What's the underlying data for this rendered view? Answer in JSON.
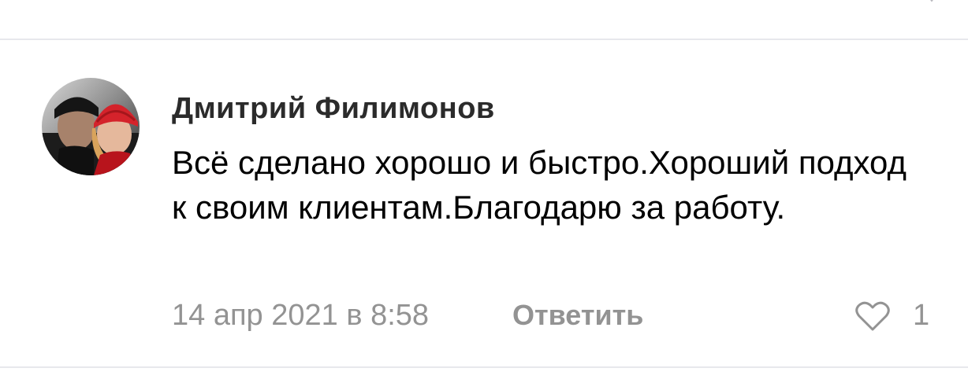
{
  "comment": {
    "author": "Дмитрий Филимонов",
    "text": "Всё сделано хорошо и быстро.Хороший подход к своим клиентам.Благодарю за работу.",
    "date": "14 апр 2021 в 8:58",
    "reply_label": "Ответить",
    "likes": "1",
    "avatar_icon": "user-avatar",
    "like_icon": "heart-outline-icon"
  },
  "colors": {
    "meta": "#939393",
    "divider": "#e7e8ec",
    "author": "#2b2b2b"
  }
}
